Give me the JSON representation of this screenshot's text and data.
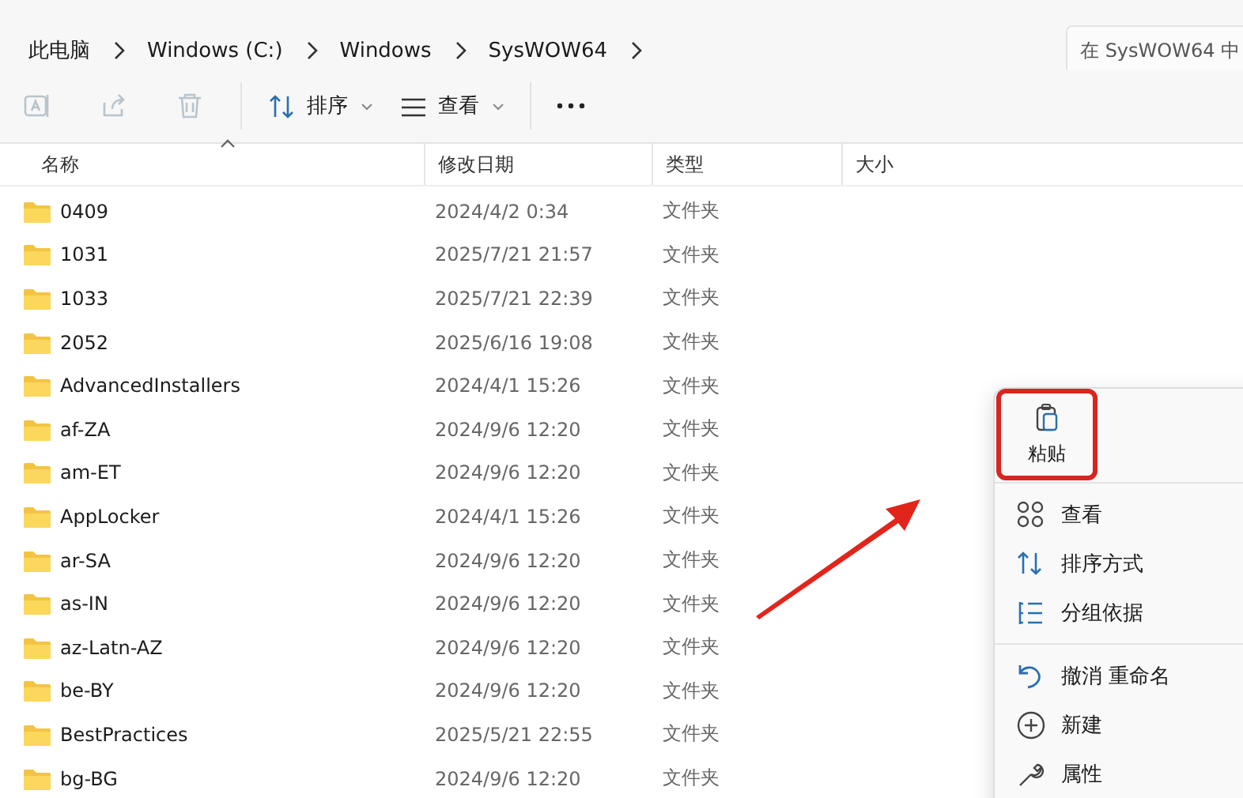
{
  "breadcrumb": [
    "此电脑",
    "Windows (C:)",
    "Windows",
    "SysWOW64"
  ],
  "search": {
    "placeholder": "在 SysWOW64 中"
  },
  "toolbar": {
    "icon_buttons": [
      {
        "disabled": true
      },
      {
        "disabled": true
      },
      {
        "disabled": true
      }
    ],
    "menus": [
      {
        "label": "排序"
      },
      {
        "label": "查看"
      }
    ]
  },
  "table": {
    "columns": [
      "名称",
      "修改日期",
      "类型",
      "大小"
    ],
    "rows": [
      {
        "name": "0409",
        "modified": "2024/4/2 0:34",
        "type": "文件夹"
      },
      {
        "name": "1031",
        "modified": "2025/7/21 21:57",
        "type": "文件夹"
      },
      {
        "name": "1033",
        "modified": "2025/7/21 22:39",
        "type": "文件夹"
      },
      {
        "name": "2052",
        "modified": "2025/6/16 19:08",
        "type": "文件夹"
      },
      {
        "name": "AdvancedInstallers",
        "modified": "2024/4/1 15:26",
        "type": "文件夹"
      },
      {
        "name": "af-ZA",
        "modified": "2024/9/6 12:20",
        "type": "文件夹"
      },
      {
        "name": "am-ET",
        "modified": "2024/9/6 12:20",
        "type": "文件夹"
      },
      {
        "name": "AppLocker",
        "modified": "2024/4/1 15:26",
        "type": "文件夹"
      },
      {
        "name": "ar-SA",
        "modified": "2024/9/6 12:20",
        "type": "文件夹"
      },
      {
        "name": "as-IN",
        "modified": "2024/9/6 12:20",
        "type": "文件夹"
      },
      {
        "name": "az-Latn-AZ",
        "modified": "2024/9/6 12:20",
        "type": "文件夹"
      },
      {
        "name": "be-BY",
        "modified": "2024/9/6 12:20",
        "type": "文件夹"
      },
      {
        "name": "BestPractices",
        "modified": "2025/5/21 22:55",
        "type": "文件夹"
      },
      {
        "name": "bg-BG",
        "modified": "2024/9/6 12:20",
        "type": "文件夹"
      }
    ]
  },
  "context_menu": {
    "paste": {
      "label": "粘贴",
      "highlighted": true
    },
    "groups": [
      [
        {
          "label": "查看"
        },
        {
          "label": "排序方式"
        },
        {
          "label": "分组依据"
        }
      ],
      [
        {
          "label": "撤消 重命名"
        },
        {
          "label": "新建"
        },
        {
          "label": "属性"
        }
      ]
    ]
  }
}
